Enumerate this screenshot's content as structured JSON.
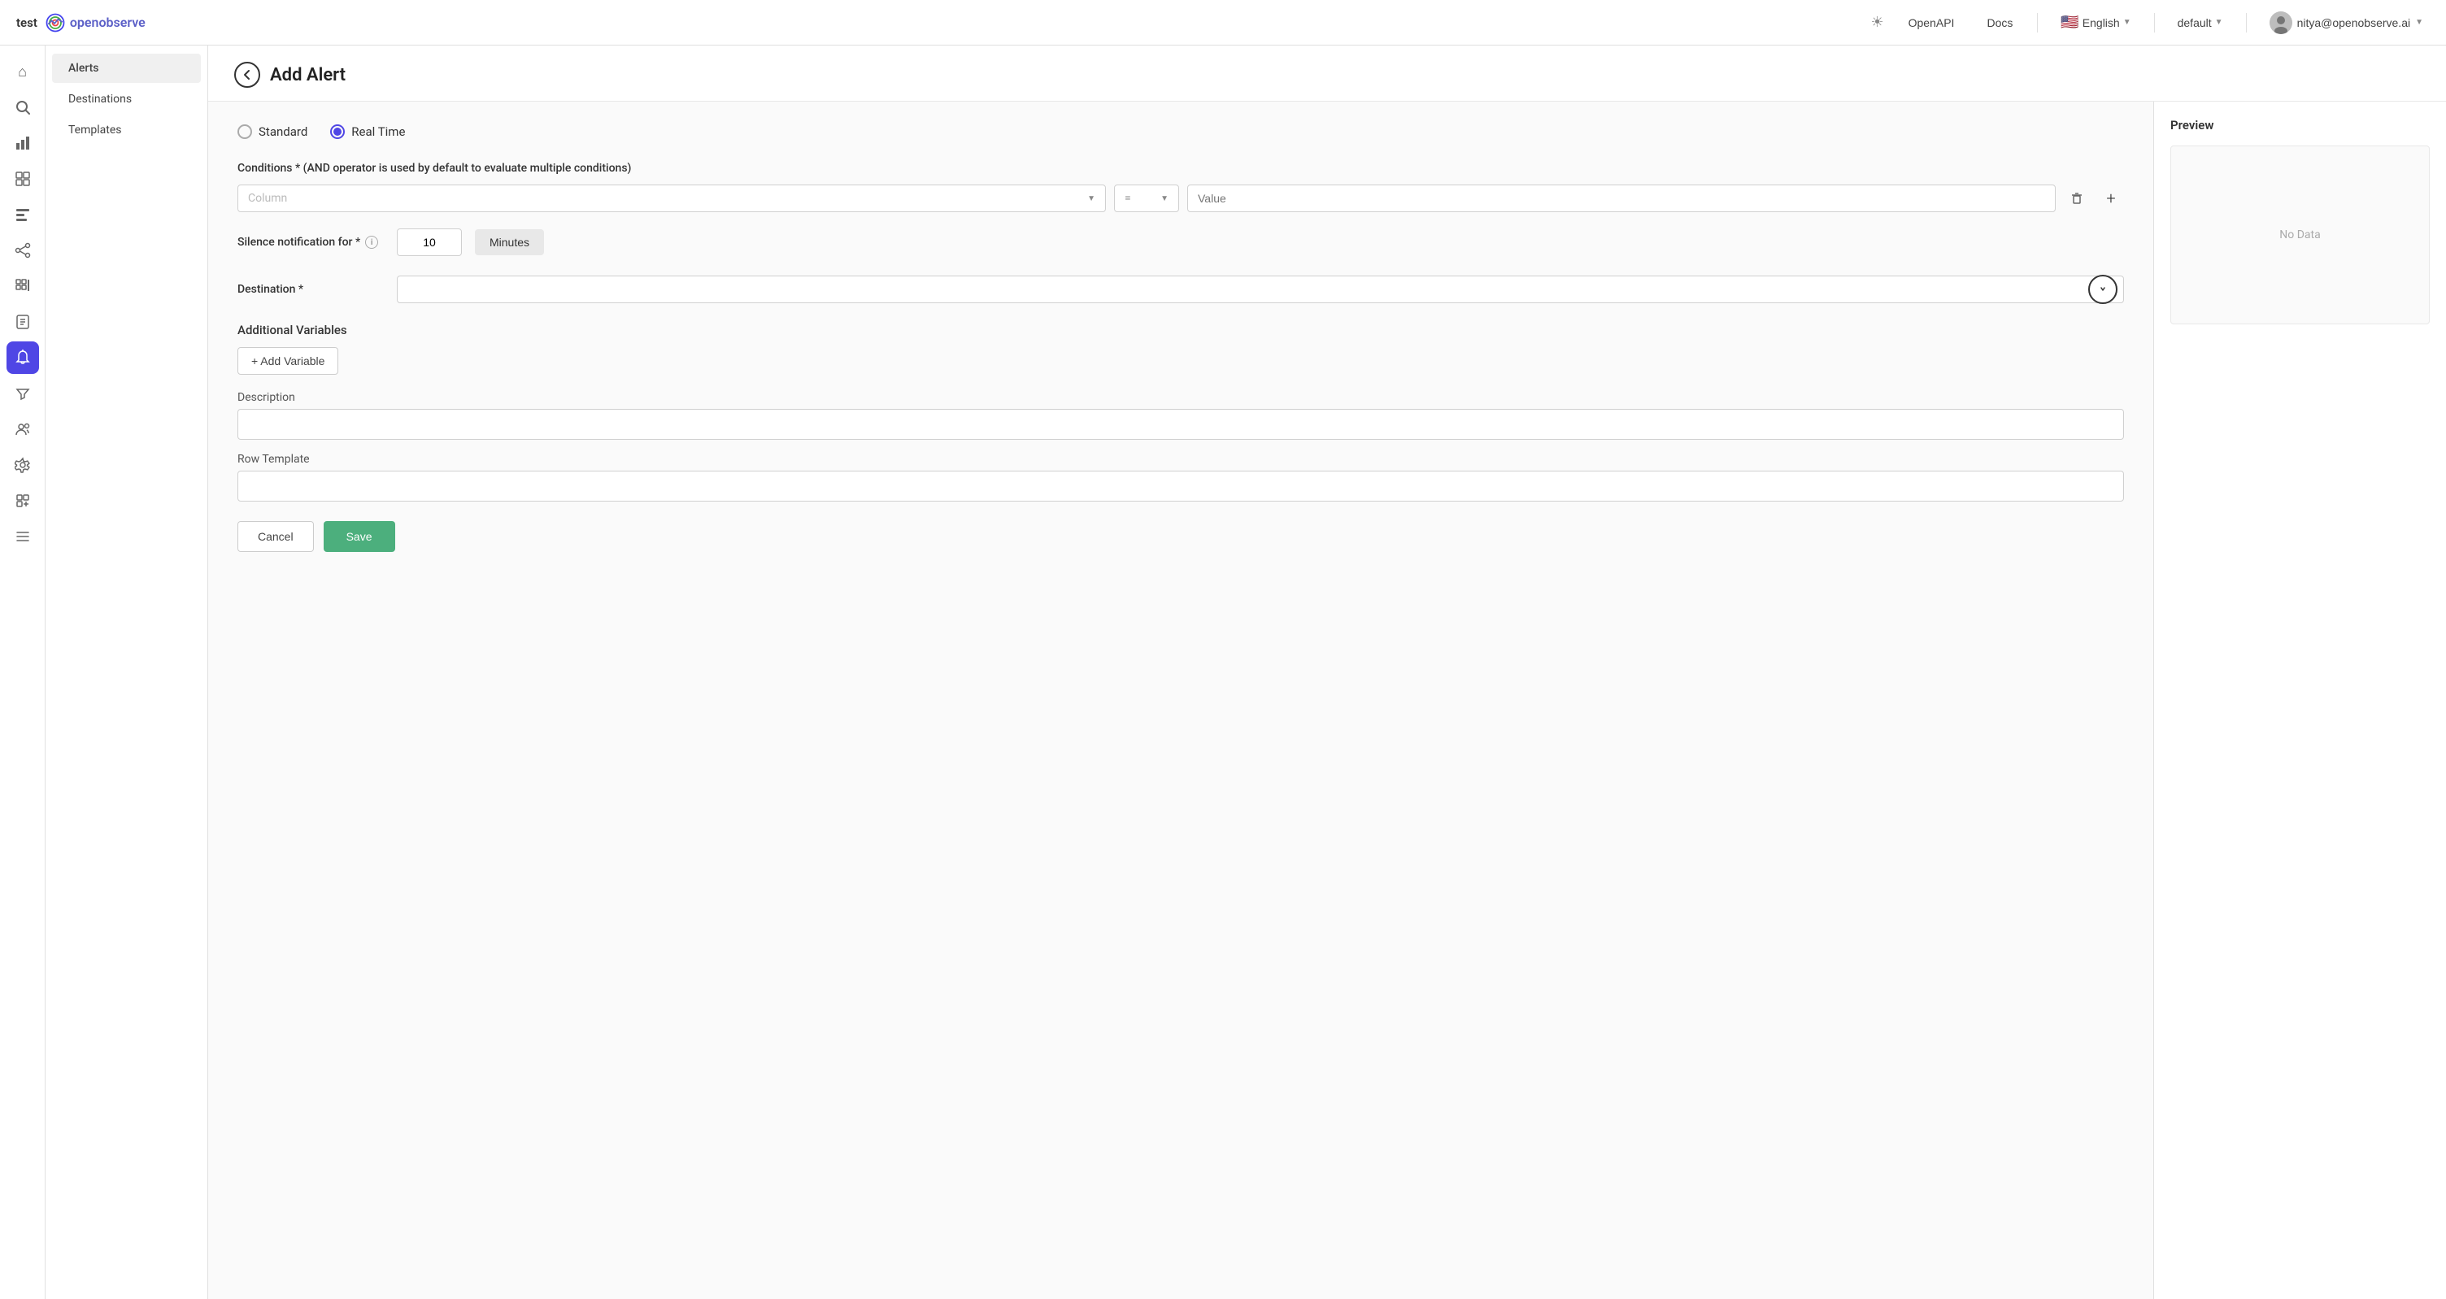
{
  "topnav": {
    "test_label": "test",
    "logo_text": "openobserve",
    "openapi_label": "OpenAPI",
    "docs_label": "Docs",
    "lang_flag": "🇺🇸",
    "lang_label": "English",
    "default_label": "default",
    "user_email": "nitya@openobserve.ai"
  },
  "sidebar": {
    "icons": [
      {
        "name": "home-icon",
        "symbol": "⌂",
        "active": false
      },
      {
        "name": "search-icon",
        "symbol": "🔍",
        "active": false
      },
      {
        "name": "chart-icon",
        "symbol": "📊",
        "active": false
      },
      {
        "name": "dashboard-icon",
        "symbol": "⊞",
        "active": false
      },
      {
        "name": "report-icon",
        "symbol": "⊟",
        "active": false
      },
      {
        "name": "share-icon",
        "symbol": "⋈",
        "active": false
      },
      {
        "name": "grid-icon",
        "symbol": "⊡",
        "active": false
      },
      {
        "name": "table-icon",
        "symbol": "⊞",
        "active": false
      },
      {
        "name": "doc-icon",
        "symbol": "📄",
        "active": false
      },
      {
        "name": "alert-icon",
        "symbol": "🔔",
        "active": true
      },
      {
        "name": "filter-icon",
        "symbol": "⛶",
        "active": false
      },
      {
        "name": "users-icon",
        "symbol": "👥",
        "active": false
      },
      {
        "name": "settings-icon",
        "symbol": "⚙",
        "active": false
      },
      {
        "name": "plugin-icon",
        "symbol": "✦",
        "active": false
      },
      {
        "name": "list-icon",
        "symbol": "☰",
        "active": false
      }
    ]
  },
  "left_panel": {
    "items": [
      {
        "label": "Alerts",
        "active": true
      },
      {
        "label": "Destinations",
        "active": false
      },
      {
        "label": "Templates",
        "active": false
      }
    ]
  },
  "page": {
    "title": "Add Alert",
    "back_tooltip": "Go back"
  },
  "form": {
    "radio_standard": "Standard",
    "radio_realtime": "Real Time",
    "selected_radio": "realtime",
    "conditions_label": "Conditions * (AND operator is used by default to evaluate multiple conditions)",
    "column_placeholder": "Column",
    "operator_placeholder": "=",
    "value_placeholder": "Value",
    "silence_label": "Silence notification for *",
    "silence_value": "10",
    "silence_unit": "Minutes",
    "destination_label": "Destination *",
    "destination_value": "",
    "additional_variables_label": "Additional Variables",
    "add_variable_label": "+ Add Variable",
    "description_label": "Description",
    "description_value": "",
    "row_template_label": "Row Template",
    "row_template_value": "",
    "cancel_label": "Cancel",
    "save_label": "Save"
  },
  "preview": {
    "title": "Preview",
    "no_data": "No Data"
  }
}
